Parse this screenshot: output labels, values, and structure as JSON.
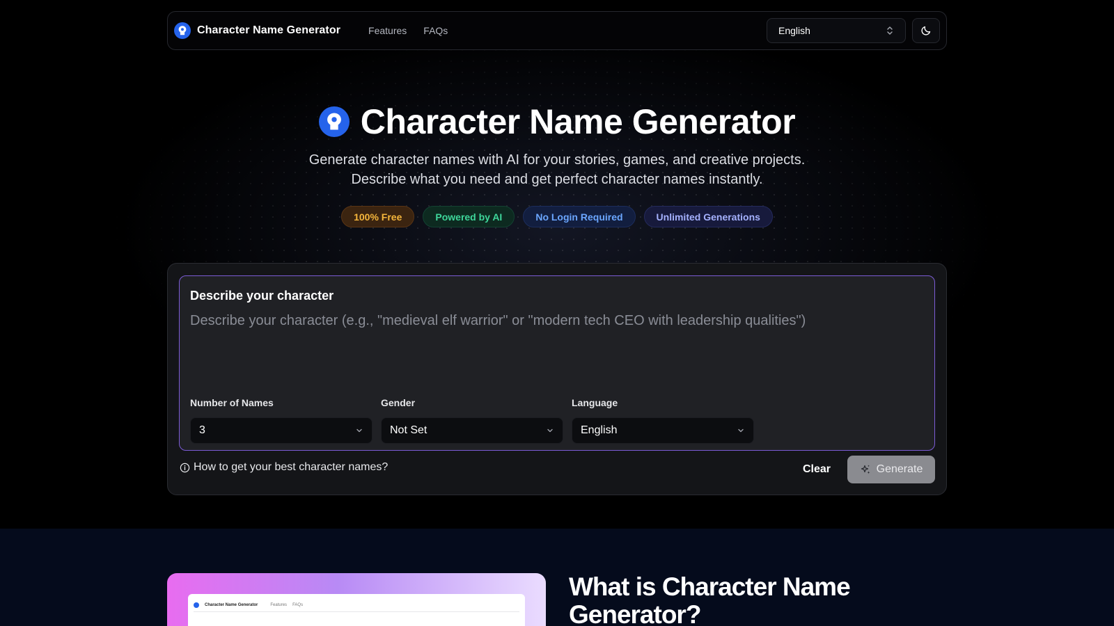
{
  "navbar": {
    "brand": "Character Name Generator",
    "links": [
      "Features",
      "FAQs"
    ],
    "language": "English",
    "theme_icon": "moon-icon"
  },
  "hero": {
    "title": "Character Name Generator",
    "subtitle_line1": "Generate character names with AI for your stories, games, and creative projects.",
    "subtitle_line2": "Describe what you need and get perfect character names instantly.",
    "badges": [
      "100% Free",
      "Powered by AI",
      "No Login Required",
      "Unlimited Generations"
    ]
  },
  "generator": {
    "field_title": "Describe your character",
    "placeholder": "Describe your character (e.g., \"medieval elf warrior\" or \"modern tech CEO with leadership qualities\")",
    "number_label": "Number of Names",
    "number_value": "3",
    "gender_label": "Gender",
    "gender_value": "Not Set",
    "language_label": "Language",
    "language_value": "English",
    "help_text": "How to get your best character names?",
    "clear_label": "Clear",
    "generate_label": "Generate"
  },
  "section2": {
    "title": "What is Character Name Generator?",
    "preview_brand": "Character Name Generator",
    "preview_links": [
      "Features",
      "FAQs"
    ]
  },
  "colors": {
    "accent": "#7c5cd6",
    "brand_blue": "#2563eb",
    "badge_free": "#f5b63c",
    "badge_ai": "#3ed69a",
    "badge_login": "#6ba6ff",
    "badge_unlimited": "#a6b2ff"
  }
}
